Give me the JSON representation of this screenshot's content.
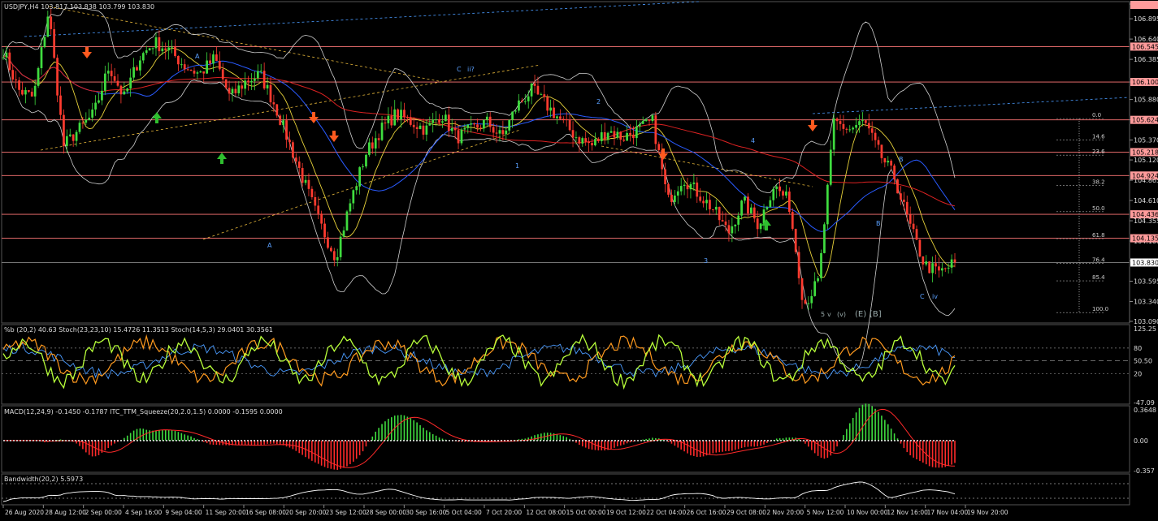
{
  "window": {
    "title_symbol": "USDJPY,H4",
    "ohlc": "103.817 103.838 103.799 103.830"
  },
  "colors": {
    "background": "#000000",
    "bull": "#3fdc3f",
    "bear": "#ff3b2f",
    "hline": "#ff7777",
    "sma": "#dd2222",
    "bands": "#cfcfcf",
    "axis_text": "#dddddd",
    "price_tag_bg": "#ff9b9b",
    "current_tag_bg": "#ffffff",
    "arrow_down": "#ff5a1f",
    "arrow_up": "#2fbf2f",
    "stoch_k": "#b8ff3a",
    "stoch_slow": "#ff9a1f",
    "stoch_blue": "#4a9bff",
    "macd_hist_pos": "#3fdc3f",
    "macd_hist_neg": "#ff2a2a",
    "macd_signal": "#ff2a2a",
    "bandwidth": "#ffffff"
  },
  "chart_data": [
    {
      "type": "candlestick",
      "title": "USDJPY,H4",
      "price_axis_ticks": [
        "107.080",
        "106.895",
        "106.640",
        "106.385",
        "106.100",
        "105.880",
        "105.625",
        "105.370",
        "105.120",
        "104.865",
        "104.610",
        "104.355",
        "104.100",
        "103.850",
        "103.595",
        "103.340",
        "103.090"
      ],
      "ylim": [
        103.09,
        107.08
      ],
      "x_ticks": [
        "26 Aug 2020",
        "28 Aug 12:00",
        "2 Sep 00:00",
        "4 Sep 16:00",
        "9 Sep 04:00",
        "11 Sep 20:00",
        "16 Sep 08:00",
        "20 Sep 20:00",
        "23 Sep 12:00",
        "28 Sep 00:00",
        "30 Sep 16:00",
        "5 Oct 04:00",
        "7 Oct 20:00",
        "12 Oct 08:00",
        "15 Oct 00:00",
        "19 Oct 12:00",
        "22 Oct 04:00",
        "26 Oct 16:00",
        "29 Oct 08:00",
        "2 Nov 20:00",
        "5 Nov 12:00",
        "10 Nov 00:00",
        "12 Nov 16:00",
        "17 Nov 04:00",
        "19 Nov 20:00"
      ],
      "close_path": [
        106.5,
        106.0,
        105.9,
        107.0,
        105.3,
        105.5,
        105.7,
        106.3,
        105.9,
        106.4,
        106.6,
        106.5,
        106.3,
        106.2,
        106.4,
        105.9,
        106.1,
        106.2,
        105.8,
        105.3,
        104.8,
        104.3,
        103.9,
        104.6,
        105.2,
        105.5,
        105.7,
        105.6,
        105.5,
        105.7,
        105.4,
        105.5,
        105.6,
        105.4,
        105.8,
        106.0,
        105.8,
        105.6,
        105.4,
        105.3,
        105.5,
        105.4,
        105.5,
        105.6,
        104.6,
        104.9,
        104.7,
        104.5,
        104.2,
        104.6,
        104.3,
        104.8,
        104.6,
        103.3,
        103.6,
        105.6,
        105.5,
        105.6,
        105.2,
        104.9,
        104.3,
        103.8,
        103.7,
        103.83
      ],
      "current_price": "103.830",
      "horizontal_levels": [
        "106.545",
        "106.100",
        "105.624",
        "105.218",
        "104.924",
        "104.436",
        "104.135"
      ],
      "fib_levels": [
        {
          "label": "0.0",
          "price": 105.64
        },
        {
          "label": "14.6",
          "price": 105.37
        },
        {
          "label": "23.6",
          "price": 105.18
        },
        {
          "label": "38.2",
          "price": 104.8
        },
        {
          "label": "50.0",
          "price": 104.47
        },
        {
          "label": "61.8",
          "price": 104.13
        },
        {
          "label": "76.4",
          "price": 103.82
        },
        {
          "label": "85.4",
          "price": 103.6
        },
        {
          "label": "100.0",
          "price": 103.2
        }
      ],
      "wave_labels": [
        "A",
        "B",
        "C",
        "iv",
        "1",
        "2",
        "3",
        "4",
        "A",
        "B",
        "C",
        "ii?",
        "5",
        "v",
        "(v)",
        "(E)",
        "[B]"
      ]
    },
    {
      "type": "line",
      "title": "%b (20,2) 40.63  Stoch(23,23,10) 15.4726 11.3513  Stoch(14,5,3) 29.0401 30.3561",
      "ticks": [
        "125.25",
        "80",
        "50.50",
        "20",
        "-47.09"
      ],
      "ylim": [
        -47.09,
        125.25
      ]
    },
    {
      "type": "bar",
      "title": "MACD(12,24,9) -0.1450 -0.1787  ITC_TTM_Squeeze(20,2.0,1.5) 0.0000 -0.1595 0.0000",
      "ticks": [
        "0.3648",
        "0.00",
        "-0.357"
      ],
      "ylim": [
        -0.357,
        0.3648
      ]
    },
    {
      "type": "line",
      "title": "Bandwidth(20,2) 5.5973",
      "ticks": []
    }
  ]
}
